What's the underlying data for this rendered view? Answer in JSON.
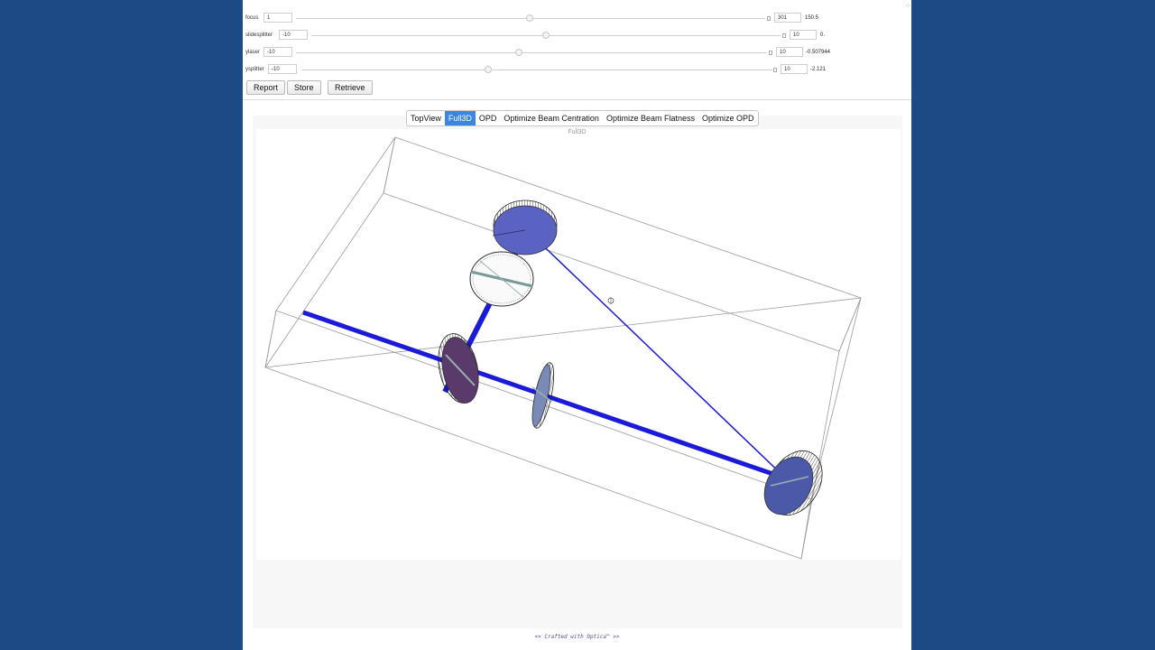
{
  "controls": [
    {
      "label": "focus",
      "min": "1",
      "max": "301",
      "value": "150.5",
      "fraction": 0.5
    },
    {
      "label": "slidesplitter",
      "min": "-10",
      "max": "10",
      "value": "0.",
      "fraction": 0.5
    },
    {
      "label": "ylaser",
      "min": "-10",
      "max": "10",
      "value": "-0.507944",
      "fraction": 0.475
    },
    {
      "label": "ysplitter",
      "min": "-10",
      "max": "10",
      "value": "-2.121",
      "fraction": 0.4
    }
  ],
  "buttons": {
    "report": "Report",
    "store": "Store",
    "retrieve": "Retrieve"
  },
  "tabs": [
    {
      "label": "TopView",
      "active": false
    },
    {
      "label": "Full3D",
      "active": true
    },
    {
      "label": "OPD",
      "active": false
    },
    {
      "label": "Optimize Beam Centration",
      "active": false
    },
    {
      "label": "Optimize Beam Flatness",
      "active": false
    },
    {
      "label": "Optimize OPD",
      "active": false
    }
  ],
  "view": {
    "title": "Full3D"
  },
  "footer": "<< Crafted with Optica™ >>",
  "colors": {
    "beam": "#1a1ad8",
    "element": "#5a62c2",
    "background": "#1d4a84",
    "tab_active": "#3a86e0"
  }
}
